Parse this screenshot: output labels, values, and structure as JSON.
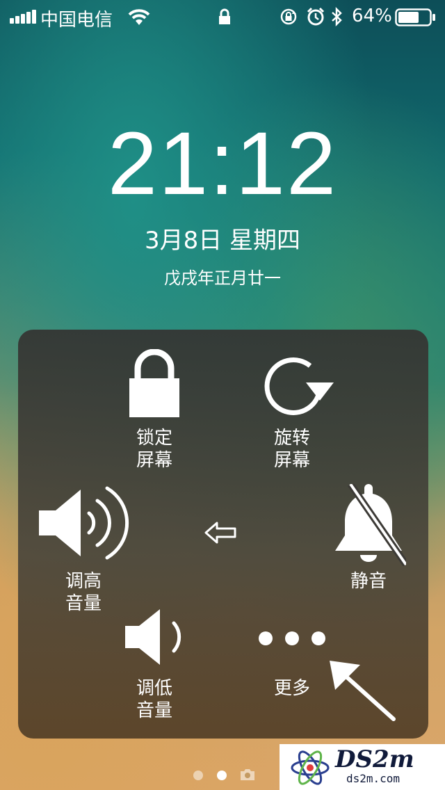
{
  "status_bar": {
    "carrier": "中国电信",
    "battery_percent": "64%",
    "battery_level": 0.64,
    "icons": [
      "signal-icon",
      "wifi-icon",
      "lock-icon",
      "rotation-lock-icon",
      "alarm-icon",
      "bluetooth-icon",
      "battery-icon"
    ]
  },
  "lock_screen": {
    "time": "21:12",
    "date": "3月8日 星期四",
    "lunar_date": "戊戌年正月廿一"
  },
  "assistive_touch": {
    "lock_screen_label_1": "锁定",
    "lock_screen_label_2": "屏幕",
    "rotate_label_1": "旋转",
    "rotate_label_2": "屏幕",
    "volume_up_label_1": "调高",
    "volume_up_label_2": "音量",
    "mute_label": "静音",
    "volume_down_label_1": "调低",
    "volume_down_label_2": "音量",
    "more_label": "更多"
  },
  "watermark": {
    "title": "DS2m",
    "url": "ds2m.com"
  }
}
